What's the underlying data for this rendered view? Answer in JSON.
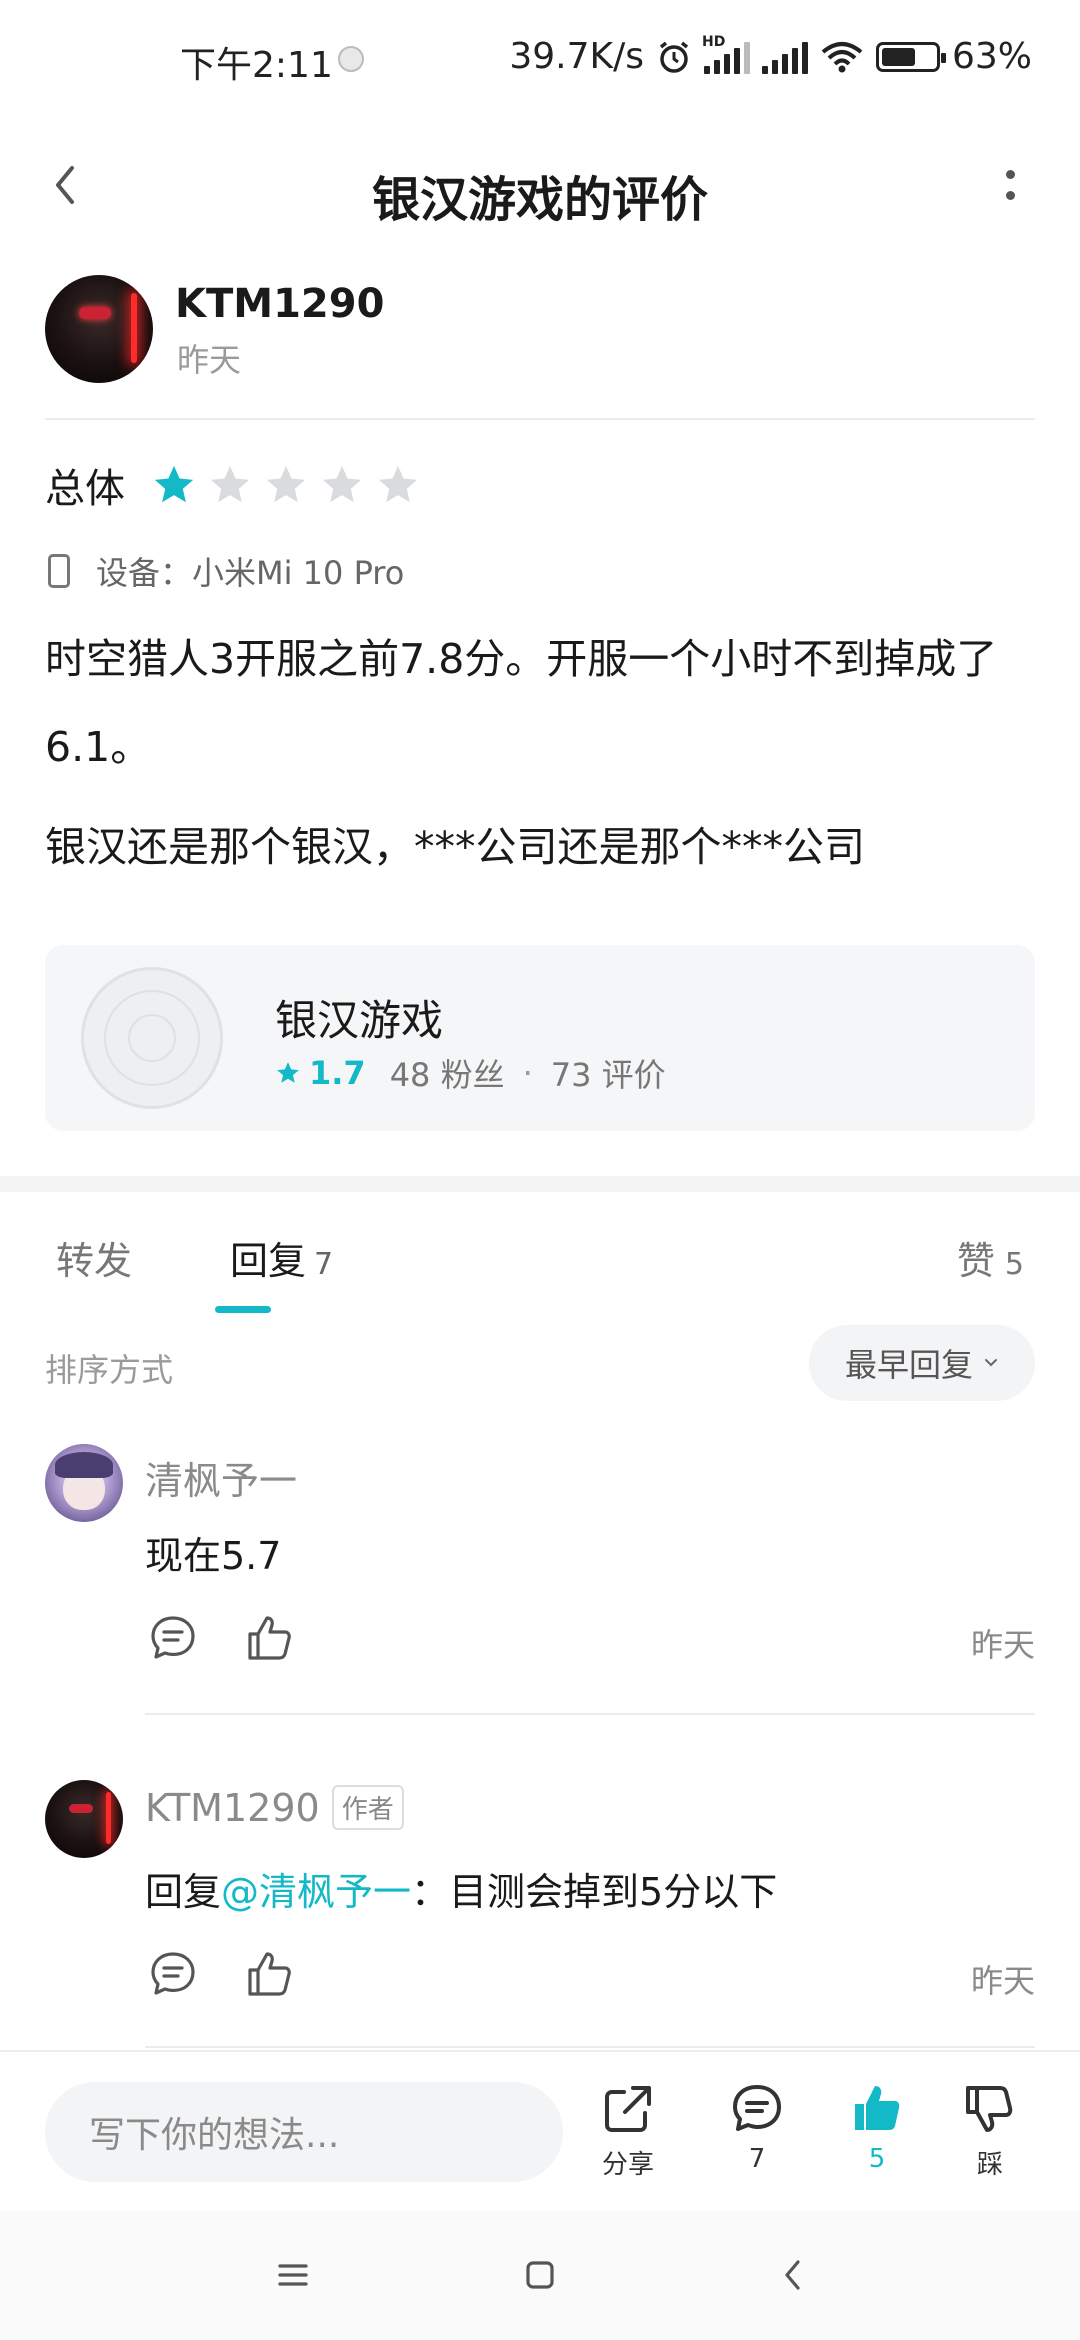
{
  "status_bar": {
    "time": "下午2:11",
    "net_speed": "39.7K/s",
    "hd_label": "HD",
    "battery_pct": "63%",
    "battery_level": 0.63
  },
  "header": {
    "title": "银汉游戏的评价",
    "back_icon": "chevron-left-icon",
    "more_icon": "more-vertical-icon"
  },
  "author": {
    "name": "KTM1290",
    "time": "昨天"
  },
  "review": {
    "rating_label": "总体",
    "rating": 1,
    "max_rating": 5,
    "device": "设备：小米Mi 10 Pro",
    "paragraphs": [
      "时空猎人3开服之前7.8分。开服一个小时不到掉成了6.1。",
      "银汉还是那个银汉，***公司还是那个***公司"
    ]
  },
  "game_card": {
    "name": "银汉游戏",
    "score": "1.7",
    "fans": "48 粉丝",
    "separator": "·",
    "reviews": "73 评价"
  },
  "tabs": {
    "repost": "转发",
    "reply": "回复",
    "reply_count": "7",
    "like": "赞",
    "like_count": "5"
  },
  "sort": {
    "label": "排序方式",
    "value": "最早回复"
  },
  "comments": [
    {
      "name": "清枫予一",
      "text": "现在5.7",
      "time": "昨天"
    },
    {
      "name": "KTM1290",
      "badge": "作者",
      "reply_prefix": "回复",
      "mention": "@清枫予一",
      "text": "：目测会掉到5分以下",
      "time": "昨天"
    }
  ],
  "bottom_bar": {
    "placeholder": "写下你的想法...",
    "share_label": "分享",
    "comment_count": "7",
    "like_count": "5",
    "dislike_label": "踩"
  },
  "colors": {
    "accent": "#14b9c8",
    "star_empty": "#d9dcdf",
    "text_primary": "#1a1a1a",
    "text_secondary": "#8a8a8a"
  }
}
